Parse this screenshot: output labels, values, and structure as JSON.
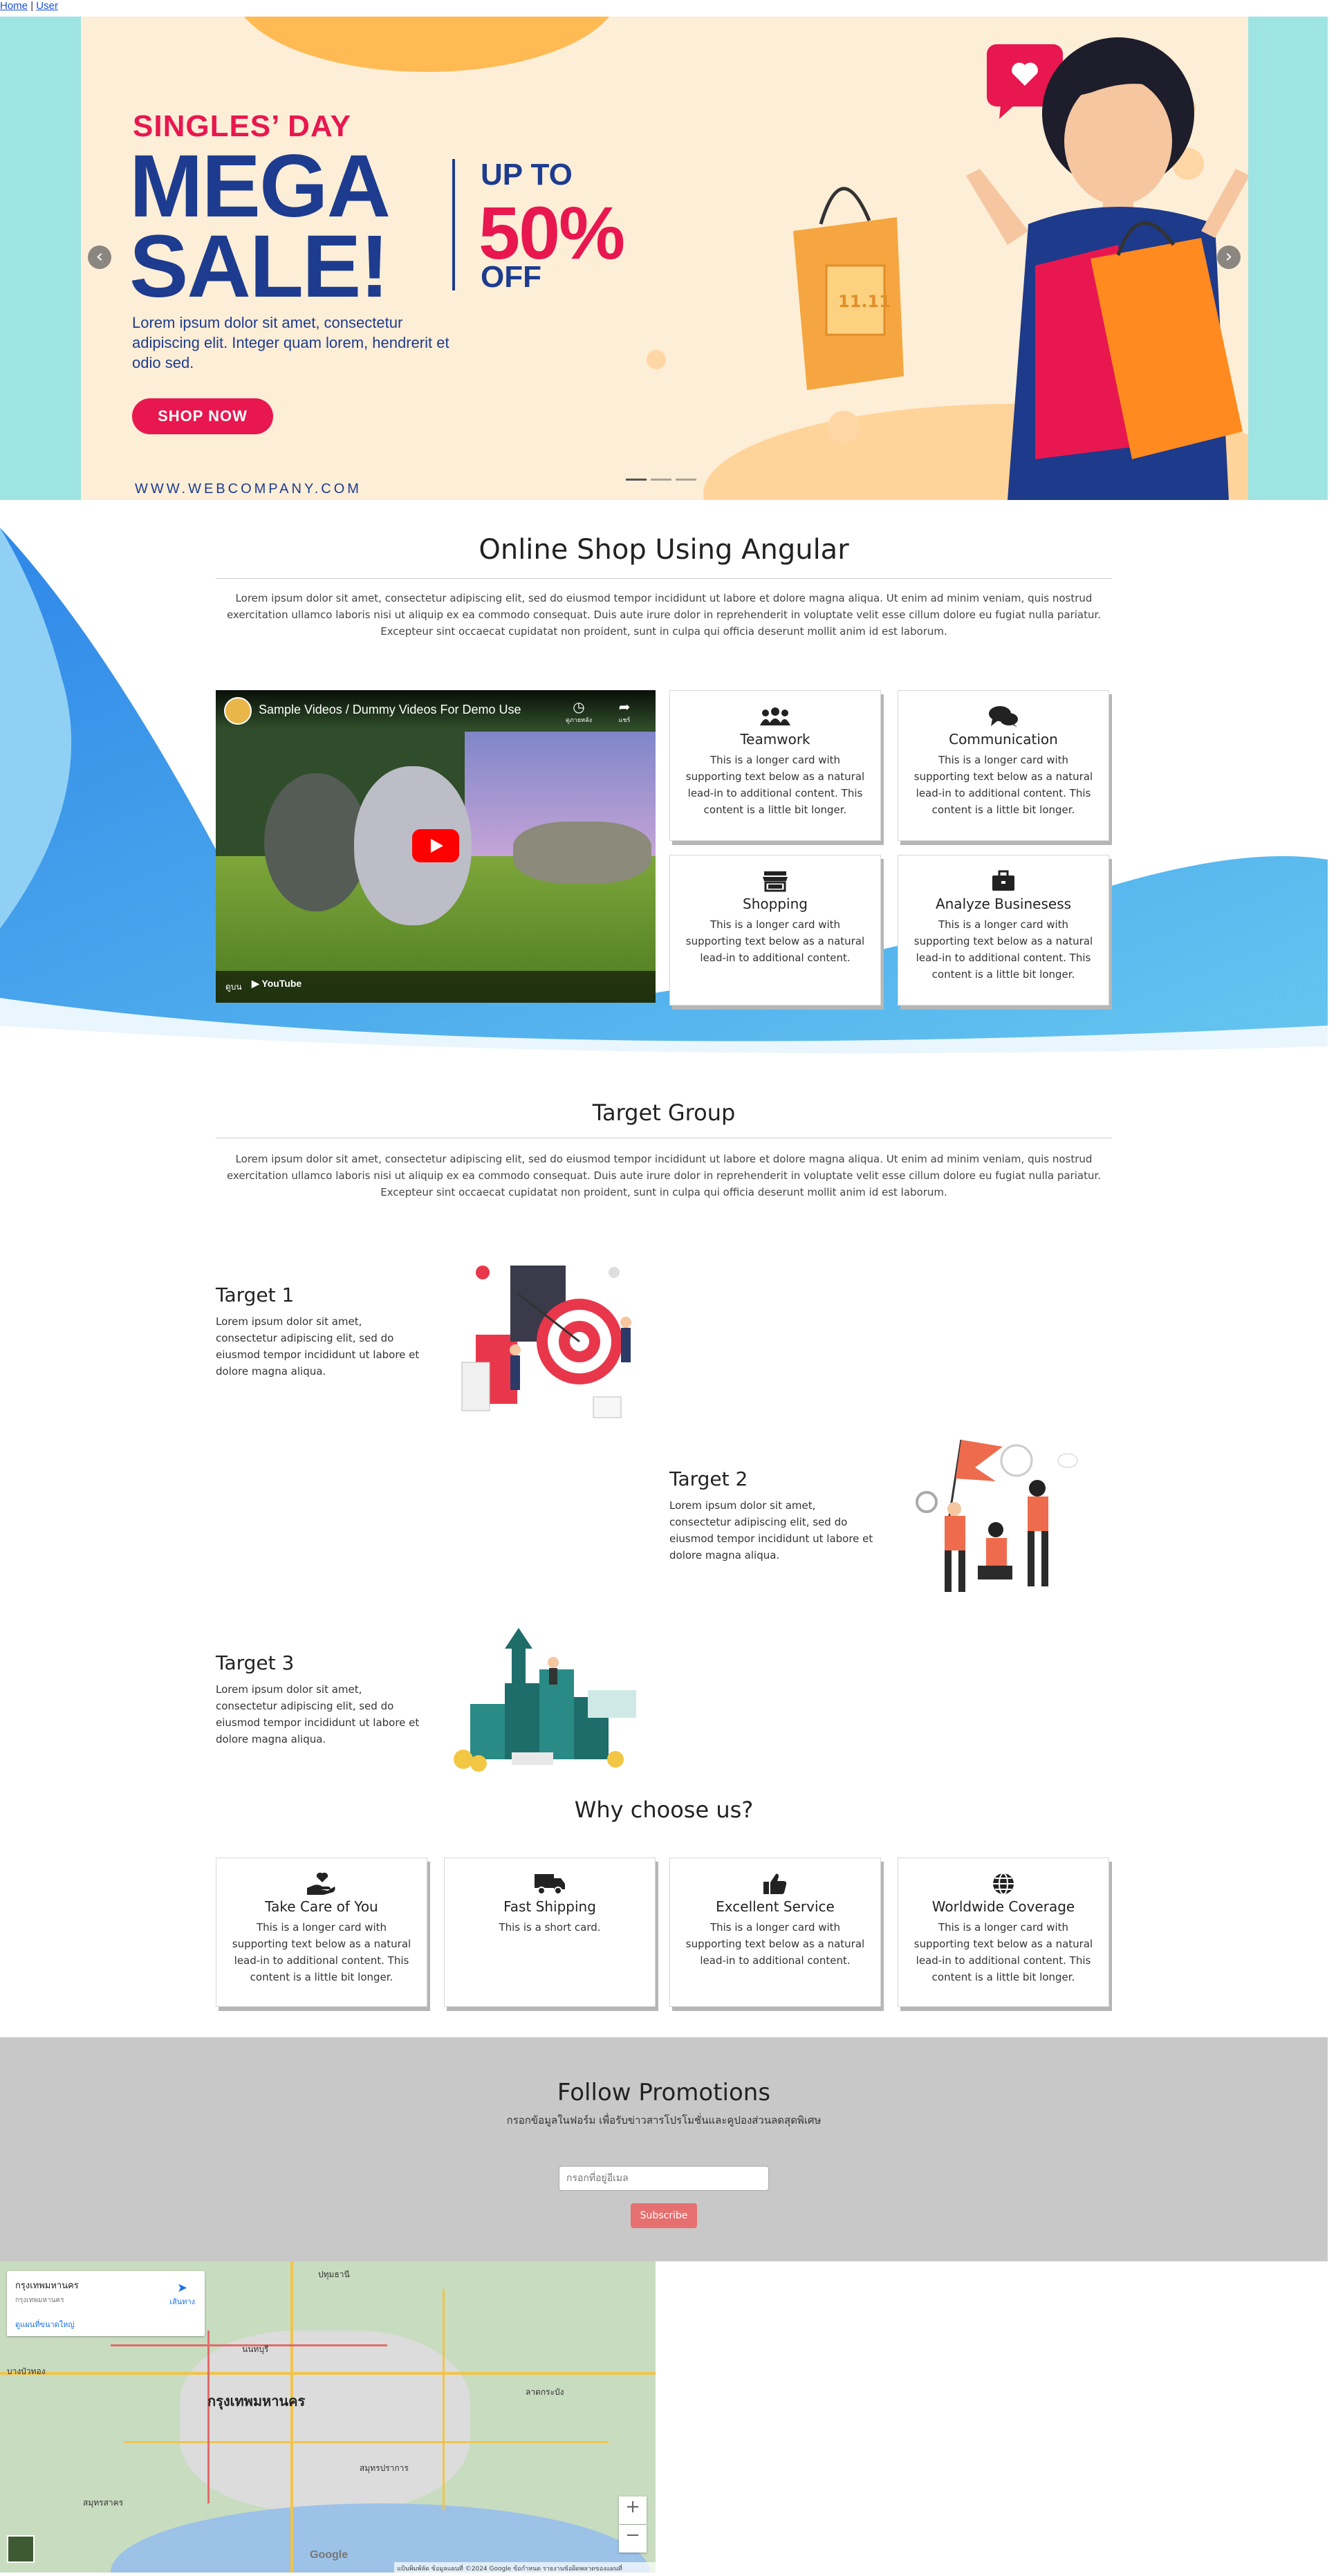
{
  "nav": {
    "home": "Home",
    "separator": "|",
    "user": "User"
  },
  "banner": {
    "event": "SINGLES’ DAY",
    "headline_1": "MEGA",
    "headline_2": "SALE!",
    "up_to": "UP TO",
    "percent": "50%",
    "off": "OFF",
    "description": "Lorem ipsum dolor sit amet, consectetur adipiscing elit. Integer quam lorem, hendrerit et odio sed.",
    "cta": "SHOP NOW",
    "website": "WWW.WEBCOMPANY.COM",
    "bag_label": "11.11",
    "prev": "‹",
    "next": "›",
    "slides": 3,
    "active_slide": 1,
    "colors": {
      "navy": "#1d3c8f",
      "pink": "#e8174f",
      "background": "#fdeed7",
      "side": "#9ee4e3"
    }
  },
  "about": {
    "title": "Online Shop Using Angular",
    "text": "Lorem ipsum dolor sit amet, consectetur adipiscing elit, sed do eiusmod tempor incididunt ut labore et dolore magna aliqua. Ut enim ad minim veniam, quis nostrud exercitation ullamco laboris nisi ut aliquip ex ea commodo consequat. Duis aute irure dolor in reprehenderit in voluptate velit esse cillum dolore eu fugiat nulla pariatur. Excepteur sint occaecat cupidatat non proident, sunt in culpa qui officia deserunt mollit anim id est laborum."
  },
  "video": {
    "title": "Sample Videos / Dummy Videos For Demo Use",
    "watch_later": "ดูภายหลัง",
    "share": "แชร์",
    "watch_on": "ดูบน",
    "platform": "YouTube"
  },
  "feature_cards": [
    {
      "icon": "users-icon",
      "title": "Teamwork",
      "text": "This is a longer card with supporting text below as a natural lead-in to additional content. This content is a little bit longer."
    },
    {
      "icon": "comments-icon",
      "title": "Communication",
      "text": "This is a longer card with supporting text below as a natural lead-in to additional content. This content is a little bit longer."
    },
    {
      "icon": "store-icon",
      "title": "Shopping",
      "text": "This is a longer card with supporting text below as a natural lead-in to additional content."
    },
    {
      "icon": "briefcase-icon",
      "title": "Analyze Businesess",
      "text": "This is a longer card with supporting text below as a natural lead-in to additional content. This content is a little bit longer."
    }
  ],
  "target_group": {
    "title": "Target Group",
    "text": "Lorem ipsum dolor sit amet, consectetur adipiscing elit, sed do eiusmod tempor incididunt ut labore et dolore magna aliqua. Ut enim ad minim veniam, quis nostrud exercitation ullamco laboris nisi ut aliquip ex ea commodo consequat. Duis aute irure dolor in reprehenderit in voluptate velit esse cillum dolore eu fugiat nulla pariatur. Excepteur sint occaecat cupidatat non proident, sunt in culpa qui officia deserunt mollit anim id est laborum.",
    "targets": [
      {
        "title": "Target 1",
        "text": "Lorem ipsum dolor sit amet, consectetur adipiscing elit, sed do eiusmod tempor incididunt ut labore et dolore magna aliqua."
      },
      {
        "title": "Target 2",
        "text": "Lorem ipsum dolor sit amet, consectetur adipiscing elit, sed do eiusmod tempor incididunt ut labore et dolore magna aliqua."
      },
      {
        "title": "Target 3",
        "text": "Lorem ipsum dolor sit amet, consectetur adipiscing elit, sed do eiusmod tempor incididunt ut labore et dolore magna aliqua."
      }
    ]
  },
  "why": {
    "title": "Why choose us?",
    "cards": [
      {
        "icon": "hand-holding-heart-icon",
        "title": "Take Care of You",
        "text": "This is a longer card with supporting text below as a natural lead-in to additional content. This content is a little bit longer."
      },
      {
        "icon": "truck-icon",
        "title": "Fast Shipping",
        "text": "This is a short card."
      },
      {
        "icon": "thumbs-up-icon",
        "title": "Excellent Service",
        "text": "This is a longer card with supporting text below as a natural lead-in to additional content."
      },
      {
        "icon": "globe-icon",
        "title": "Worldwide Coverage",
        "text": "This is a longer card with supporting text below as a natural lead-in to additional content. This content is a little bit longer."
      }
    ]
  },
  "promotions": {
    "title": "Follow Promotions",
    "subtitle": "กรอกข้อมูลในฟอร์ม เพื่อรับข่าวสารโปรโมชั่นและคูปองส่วนลดสุดพิเศษ",
    "placeholder": "กรอกที่อยู่อีเมล",
    "button": "Subscribe",
    "button_color": "#e66f6f"
  },
  "map": {
    "place_name": "กรุงเทพมหานคร",
    "place_sub": "กรุงเทพมหานคร",
    "directions": "เส้นทาง",
    "larger_map": "ดูแผนที่ขนาดใหญ่",
    "city_label": "กรุงเทพมหานคร",
    "labels": [
      "ปทุมธานี",
      "นนทบุรี",
      "สมุทรปราการ",
      "สมุทรสาคร",
      "บางบัวทอง",
      "ลาดกระบัง"
    ],
    "zoom_in": "+",
    "zoom_out": "−",
    "google": "Google",
    "footer": "แป้นพิมพ์ลัด   ข้อมูลแผนที่ ©2024 Google   ข้อกำหนด   รายงานข้อผิดพลาดของแผนที่"
  }
}
